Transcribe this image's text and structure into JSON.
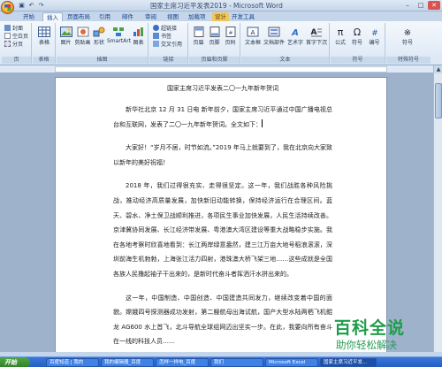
{
  "window": {
    "title": "国家主席习近平发表2019 - Microsoft Word"
  },
  "ribbon": {
    "tabs": [
      {
        "label": "开始",
        "active": false
      },
      {
        "label": "插入",
        "active": true
      },
      {
        "label": "页面布局",
        "active": false
      },
      {
        "label": "引用",
        "active": false
      },
      {
        "label": "邮件",
        "active": false
      },
      {
        "label": "审阅",
        "active": false
      },
      {
        "label": "视图",
        "active": false
      },
      {
        "label": "加载项",
        "active": false
      },
      {
        "label": "设计",
        "active": false
      },
      {
        "label": "开发工具",
        "active": false
      }
    ],
    "groups": {
      "pages": {
        "label": "页",
        "items": [
          "封面",
          "空白页",
          "分页"
        ]
      },
      "tables": {
        "label": "表格",
        "button": "表格"
      },
      "illustrations": {
        "label": "插图",
        "buttons": [
          "图片",
          "剪贴画",
          "形状",
          "SmartArt",
          "图表"
        ]
      },
      "links": {
        "label": "链接",
        "items": [
          "超链接",
          "书签",
          "交叉引用"
        ]
      },
      "header_footer": {
        "label": "页眉和页脚",
        "buttons": [
          "页眉",
          "页脚",
          "页码"
        ]
      },
      "text": {
        "label": "文本",
        "buttons": [
          "文本框",
          "文档部件",
          "艺术字",
          "首字下沉"
        ]
      },
      "symbols": {
        "label": "符号",
        "buttons": [
          "公式",
          "符号",
          "编号"
        ]
      },
      "special": {
        "label": "特殊符号",
        "button": "符号"
      }
    }
  },
  "document": {
    "title": "国家主席习近平发表二〇一九年新年贺词",
    "paragraphs": [
      "新华社北京 12 月 31 日电  新年前夕，国家主席习近平通过中国广播电视总台和互联网，发表了二〇一九年新年贺词。全文如下：",
      "大家好！“岁月不居，时节如流。”2019 年马上就要到了，我在北京向大家致以新年的美好祝福！",
      "2018 年，我们过得很充实、走得很坚定。这一年，我们战胜各种风险挑战，推动经济高质量发展，加快新旧动能转换，保持经济运行在合理区间。蓝天、碧水、净土保卫战顺利推进，各项民生事业加快发展，人民生活持续改善。京津冀协同发展、长江经济带发展、粤港澳大湾区建设等重大战略稳步实施。我在各地考察时欣喜地看到：长江两岸绿意盎然，建三江万亩大地号稻浪滚滚，深圳前海生机勃勃，上海张江活力四射，港珠澳大桥飞架三地……这些成就是全国各族人民撸起袖子干出来的，是新时代奋斗者挥洒汗水拼出来的。",
      "这一年，中国制造、中国创造、中国建造共同发力，继续改变着中国的面貌。嫦娥四号探测器成功发射，第二艘航母出海试航，国产大型水陆两栖飞机鲲龙 AG600 水上首飞，北斗导航全球组网迈出坚实一步。在此，我要向所有奋斗在一线的科技人员……"
    ]
  },
  "taskbar": {
    "start_label": "开始",
    "tasks": [
      {
        "label": "百度知道 | 我的",
        "active": false
      },
      {
        "label": "我的编辑器_百度",
        "active": false
      },
      {
        "label": "怎样一样电_百度",
        "active": false
      },
      {
        "label": "我们",
        "active": false
      },
      {
        "label": "Microsoft Excel",
        "active": false
      },
      {
        "label": "国家主席习近平发...",
        "active": true
      }
    ]
  },
  "watermark": {
    "main": "百科全说",
    "sub": "助你轻松解决"
  },
  "colors": {
    "ribbon_text": "#15428b",
    "taskbar_blue": "#245ec4",
    "start_green": "#2f7e26",
    "watermark_green": "#1f9c4a"
  }
}
